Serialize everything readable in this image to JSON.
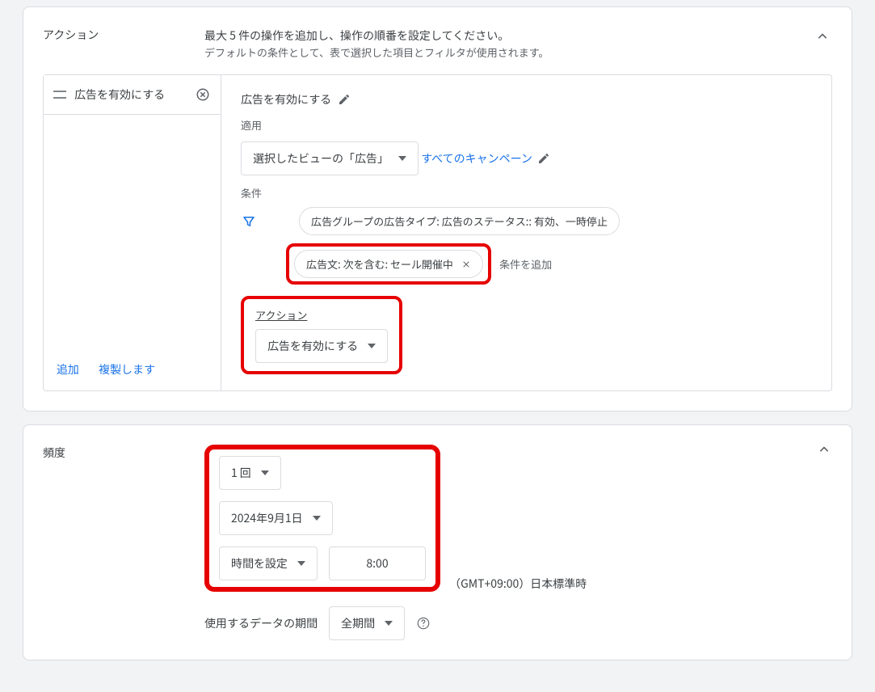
{
  "action_card": {
    "title": "アクション",
    "desc_line1": "最大 5 件の操作を追加し、操作の順番を設定してください。",
    "desc_line2": "デフォルトの条件として、表で選択した項目とフィルタが使用されます。",
    "sidebar_item": "広告を有効にする",
    "sidebar_add": "追加",
    "sidebar_duplicate": "複製します",
    "main_title": "広告を有効にする",
    "apply_label": "適用",
    "apply_dropdown": "選択したビューの「広告」",
    "campaigns_link": "すべてのキャンペーン",
    "conditions_label": "条件",
    "chip1": "広告グループの広告タイプ: 広告のステータス:: 有効、一時停止",
    "chip2": "広告文: 次を含む: セール開催中",
    "add_condition": "条件を追加",
    "action_label": "アクション",
    "action_dropdown": "広告を有効にする"
  },
  "freq_card": {
    "title": "頻度",
    "count_dropdown": "1 回",
    "date_dropdown": "2024年9月1日",
    "time_set_dropdown": "時間を設定",
    "time_value": "8:00",
    "tz": "（GMT+09:00）日本標準時",
    "period_label": "使用するデータの期間",
    "period_dropdown": "全期間"
  }
}
